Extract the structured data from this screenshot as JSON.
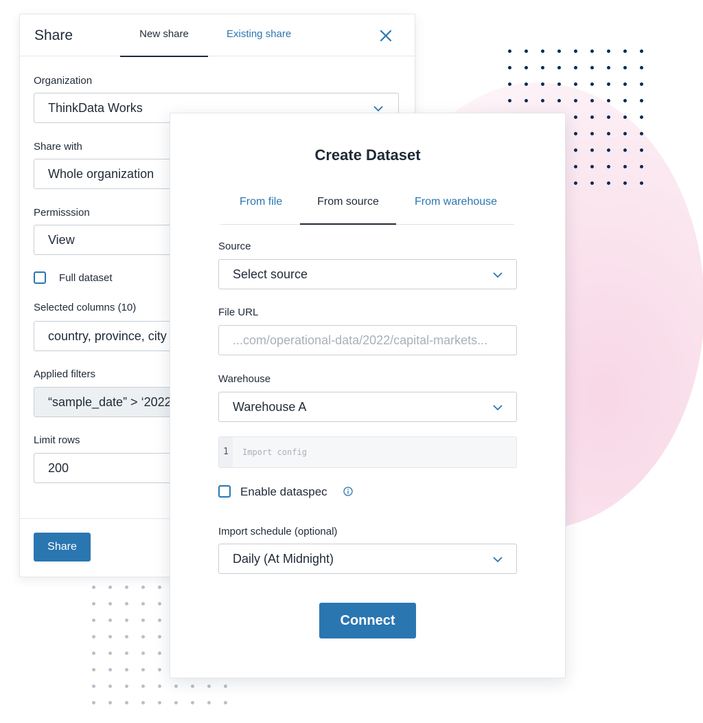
{
  "share_panel": {
    "title": "Share",
    "tabs": [
      "New share",
      "Existing share"
    ],
    "fields": {
      "organization": {
        "label": "Organization",
        "value": "ThinkData Works"
      },
      "share_with": {
        "label": "Share with",
        "value": "Whole organization"
      },
      "permission": {
        "label": "Permisssion",
        "value": "View"
      },
      "full_dataset": {
        "label": "Full dataset",
        "checked": false
      },
      "selected_columns": {
        "label": "Selected columns (10)",
        "value": "country, province, city"
      },
      "applied_filters": {
        "label": "Applied filters",
        "value": "“sample_date” > ‘2022"
      },
      "limit_rows": {
        "label": "Limit rows",
        "value": "200"
      }
    },
    "share_button": "Share"
  },
  "create_dataset": {
    "title": "Create Dataset",
    "tabs": {
      "from_file": "From file",
      "from_source": "From source",
      "from_warehouse": "From warehouse"
    },
    "active_tab": "From source",
    "source": {
      "label": "Source",
      "value": "Select source"
    },
    "file_url": {
      "label": "File URL",
      "placeholder": "...com/operational-data/2022/capital-markets..."
    },
    "warehouse": {
      "label": "Warehouse",
      "value": "Warehouse A"
    },
    "import_config": {
      "line_number": "1",
      "placeholder": "Import config"
    },
    "enable_dataspec": {
      "label": "Enable dataspec",
      "checked": false
    },
    "import_schedule": {
      "label": "Import schedule (optional)",
      "value": "Daily (At Midnight)"
    },
    "connect_button": "Connect"
  },
  "colors": {
    "accent": "#2a76b1",
    "text": "#1f2a37",
    "dots_dark": "#0b2a55",
    "dots_light": "#b7c0cf",
    "pink": "#f8d7e6"
  }
}
